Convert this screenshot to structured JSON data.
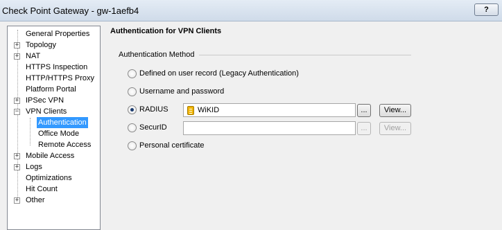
{
  "window": {
    "title": "Check Point Gateway - gw-1aefb4",
    "help_label": "?"
  },
  "tree": {
    "items": [
      {
        "label": "General Properties",
        "expandable": false
      },
      {
        "label": "Topology",
        "expandable": true
      },
      {
        "label": "NAT",
        "expandable": true
      },
      {
        "label": "HTTPS Inspection",
        "expandable": false
      },
      {
        "label": "HTTP/HTTPS Proxy",
        "expandable": false
      },
      {
        "label": "Platform Portal",
        "expandable": false
      },
      {
        "label": "IPSec VPN",
        "expandable": true
      },
      {
        "label": "VPN Clients",
        "expandable": true,
        "expanded": true
      },
      {
        "label": "Authentication",
        "child": true,
        "selected": true
      },
      {
        "label": "Office Mode",
        "child": true
      },
      {
        "label": "Remote Access",
        "child": true
      },
      {
        "label": "Mobile Access",
        "expandable": true
      },
      {
        "label": "Logs",
        "expandable": true
      },
      {
        "label": "Optimizations",
        "expandable": false
      },
      {
        "label": "Hit Count",
        "expandable": false
      },
      {
        "label": "Other",
        "expandable": true
      }
    ]
  },
  "panel": {
    "title": "Authentication for VPN Clients",
    "group_title": "Authentication Method",
    "options": {
      "user_record": "Defined on user record  (Legacy Authentication)",
      "username_password": "Username and password",
      "radius": "RADIUS",
      "securid": "SecurID",
      "personal_cert": "Personal certificate"
    },
    "radius_value": "WiKID",
    "securid_value": "",
    "browse_label": "...",
    "view_label": "View..."
  }
}
